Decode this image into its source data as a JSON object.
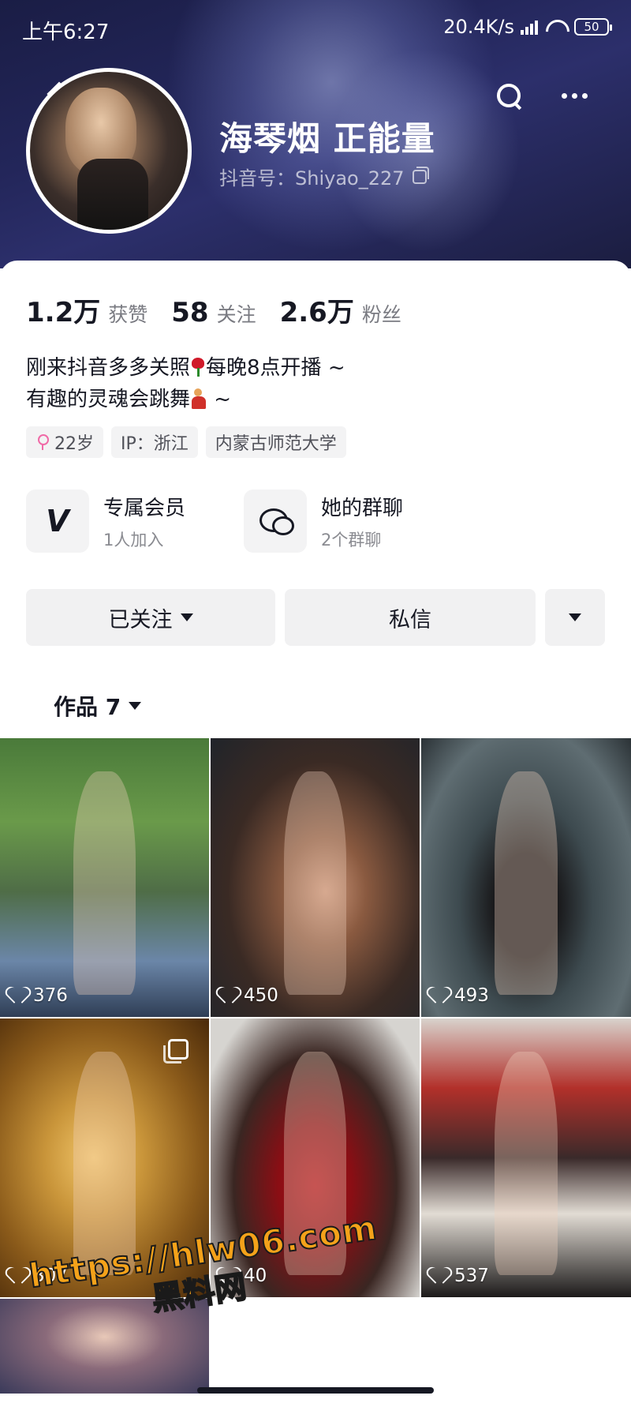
{
  "status_bar": {
    "time": "上午6:27",
    "network_speed": "20.4K/s",
    "battery": "50"
  },
  "profile": {
    "nickname": "海琴烟 正能量",
    "douyin_id": "抖音号：Shiyao_227",
    "stats": [
      {
        "num": "1.2万",
        "label": "获赞"
      },
      {
        "num": "58",
        "label": "关注"
      },
      {
        "num": "2.6万",
        "label": "粉丝"
      }
    ],
    "bio_line1_a": "刚来抖音多多关照",
    "bio_line1_b": "每晚8点开播 ~",
    "bio_line2_a": "有趣的灵魂会跳舞",
    "bio_line2_b": " ~",
    "tags": {
      "age": "22岁",
      "ip": "IP：浙江",
      "school": "内蒙古师范大学"
    }
  },
  "features": [
    {
      "title": "专属会员",
      "sub": "1人加入"
    },
    {
      "title": "她的群聊",
      "sub": "2个群聊"
    }
  ],
  "actions": {
    "follow": "已关注",
    "message": "私信"
  },
  "works": {
    "tab_label": "作品 7",
    "items": [
      {
        "likes": "376"
      },
      {
        "likes": "450"
      },
      {
        "likes": "493"
      },
      {
        "likes": "307"
      },
      {
        "likes": "40"
      },
      {
        "likes": "537"
      }
    ]
  },
  "watermark": {
    "url": "https://hlw06.com",
    "name": "黑料网"
  },
  "icons": [
    "back-icon",
    "search-icon",
    "more-icon",
    "copy-icon",
    "female-icon",
    "vip-icon",
    "group-chat-icon",
    "caret-down-icon",
    "heart-icon",
    "multi-image-icon"
  ]
}
